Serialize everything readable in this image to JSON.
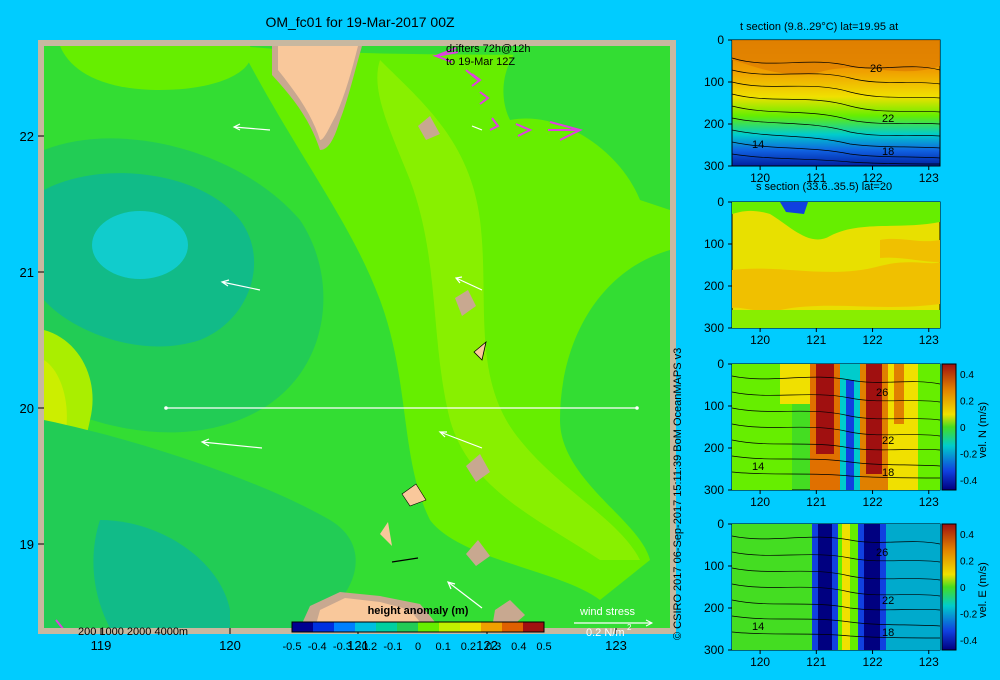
{
  "title": "OM_fc01 for 19-Mar-2017 00Z",
  "credit": "© CSIRO 2017   06-Sep-2017 15:11:39 BoM OceanMAPS v3",
  "colors": {
    "background": "#00ccff",
    "land": "#f9c89b",
    "coast_shelf": "#c8a890",
    "drifter": "#e040e0"
  },
  "map": {
    "x_ticks": [
      "119",
      "120",
      "121",
      "122",
      "123"
    ],
    "y_ticks": [
      "22",
      "21",
      "20",
      "19"
    ],
    "drifter_label_1": "drifters 72h@12h",
    "drifter_label_2": "to 19-Mar 12Z",
    "depth_legend": "200  1000  2000  4000m",
    "wind_label": "wind stress",
    "wind_scale": "0.2 N/m",
    "wind_scale_exp": "2",
    "colorbar_title": "height anomaly (m)",
    "colorbar_ticks": [
      "-0.5",
      "-0.4",
      "-0.3",
      "-0.2",
      "-0.1",
      "0",
      "0.1",
      "0.2",
      "0.3",
      "0.4",
      "0.5"
    ]
  },
  "panels": [
    {
      "title": "t section (9.8..29°C) lat=19.95 at",
      "y_ticks": [
        "0",
        "100",
        "200",
        "300"
      ],
      "x_ticks": [
        "120",
        "121",
        "122",
        "123"
      ],
      "contour_labels": [
        "26",
        "22",
        "18",
        "14"
      ]
    },
    {
      "title": "s section (33.6..35.5) lat=20",
      "y_ticks": [
        "0",
        "100",
        "200",
        "300"
      ],
      "x_ticks": [
        "120",
        "121",
        "122",
        "123"
      ],
      "contour_labels": []
    },
    {
      "title": "",
      "y_ticks": [
        "0",
        "100",
        "200",
        "300"
      ],
      "x_ticks": [
        "120",
        "121",
        "122",
        "123"
      ],
      "contour_labels": [
        "26",
        "22",
        "18",
        "14"
      ],
      "cbar_label": "vel. N  (m/s)",
      "cbar_ticks": [
        "0.4",
        "0.2",
        "0",
        "-0.2",
        "-0.4"
      ]
    },
    {
      "title": "",
      "y_ticks": [
        "0",
        "100",
        "200",
        "300"
      ],
      "x_ticks": [
        "120",
        "121",
        "122",
        "123"
      ],
      "contour_labels": [
        "26",
        "22",
        "18",
        "14"
      ],
      "cbar_label": "vel. E  (m/s)",
      "cbar_ticks": [
        "0.4",
        "0.2",
        "0",
        "-0.2",
        "-0.4"
      ]
    }
  ],
  "chart_data": [
    {
      "type": "heatmap",
      "title": "OM_fc01 for 19-Mar-2017 00Z",
      "xlabel": "",
      "ylabel": "",
      "xlim": [
        118.5,
        123.5
      ],
      "ylim": [
        18.3,
        22.7
      ],
      "x_ticks": [
        119,
        120,
        121,
        122,
        123
      ],
      "y_ticks": [
        22,
        21,
        20,
        19
      ],
      "colorbar": {
        "label": "height anomaly (m)",
        "min": -0.5,
        "max": 0.5
      },
      "section_line": {
        "lat": 20,
        "lon": [
          119.5,
          123.2
        ]
      }
    },
    {
      "type": "heatmap",
      "title": "t section (9.8..29°C) lat=19.95 at",
      "xlim": [
        119.5,
        123.2
      ],
      "ylim": [
        300,
        0
      ],
      "contour_labels": [
        26,
        22,
        18,
        14
      ]
    },
    {
      "type": "heatmap",
      "title": "s section (33.6..35.5) lat=20",
      "xlim": [
        119.5,
        123.2
      ],
      "ylim": [
        300,
        0
      ]
    },
    {
      "type": "heatmap",
      "title": "vel. N (m/s)",
      "xlim": [
        119.5,
        123.2
      ],
      "ylim": [
        300,
        0
      ],
      "colorbar": {
        "min": -0.4,
        "max": 0.4
      }
    },
    {
      "type": "heatmap",
      "title": "vel. E (m/s)",
      "xlim": [
        119.5,
        123.2
      ],
      "ylim": [
        300,
        0
      ],
      "colorbar": {
        "min": -0.4,
        "max": 0.4
      }
    }
  ]
}
